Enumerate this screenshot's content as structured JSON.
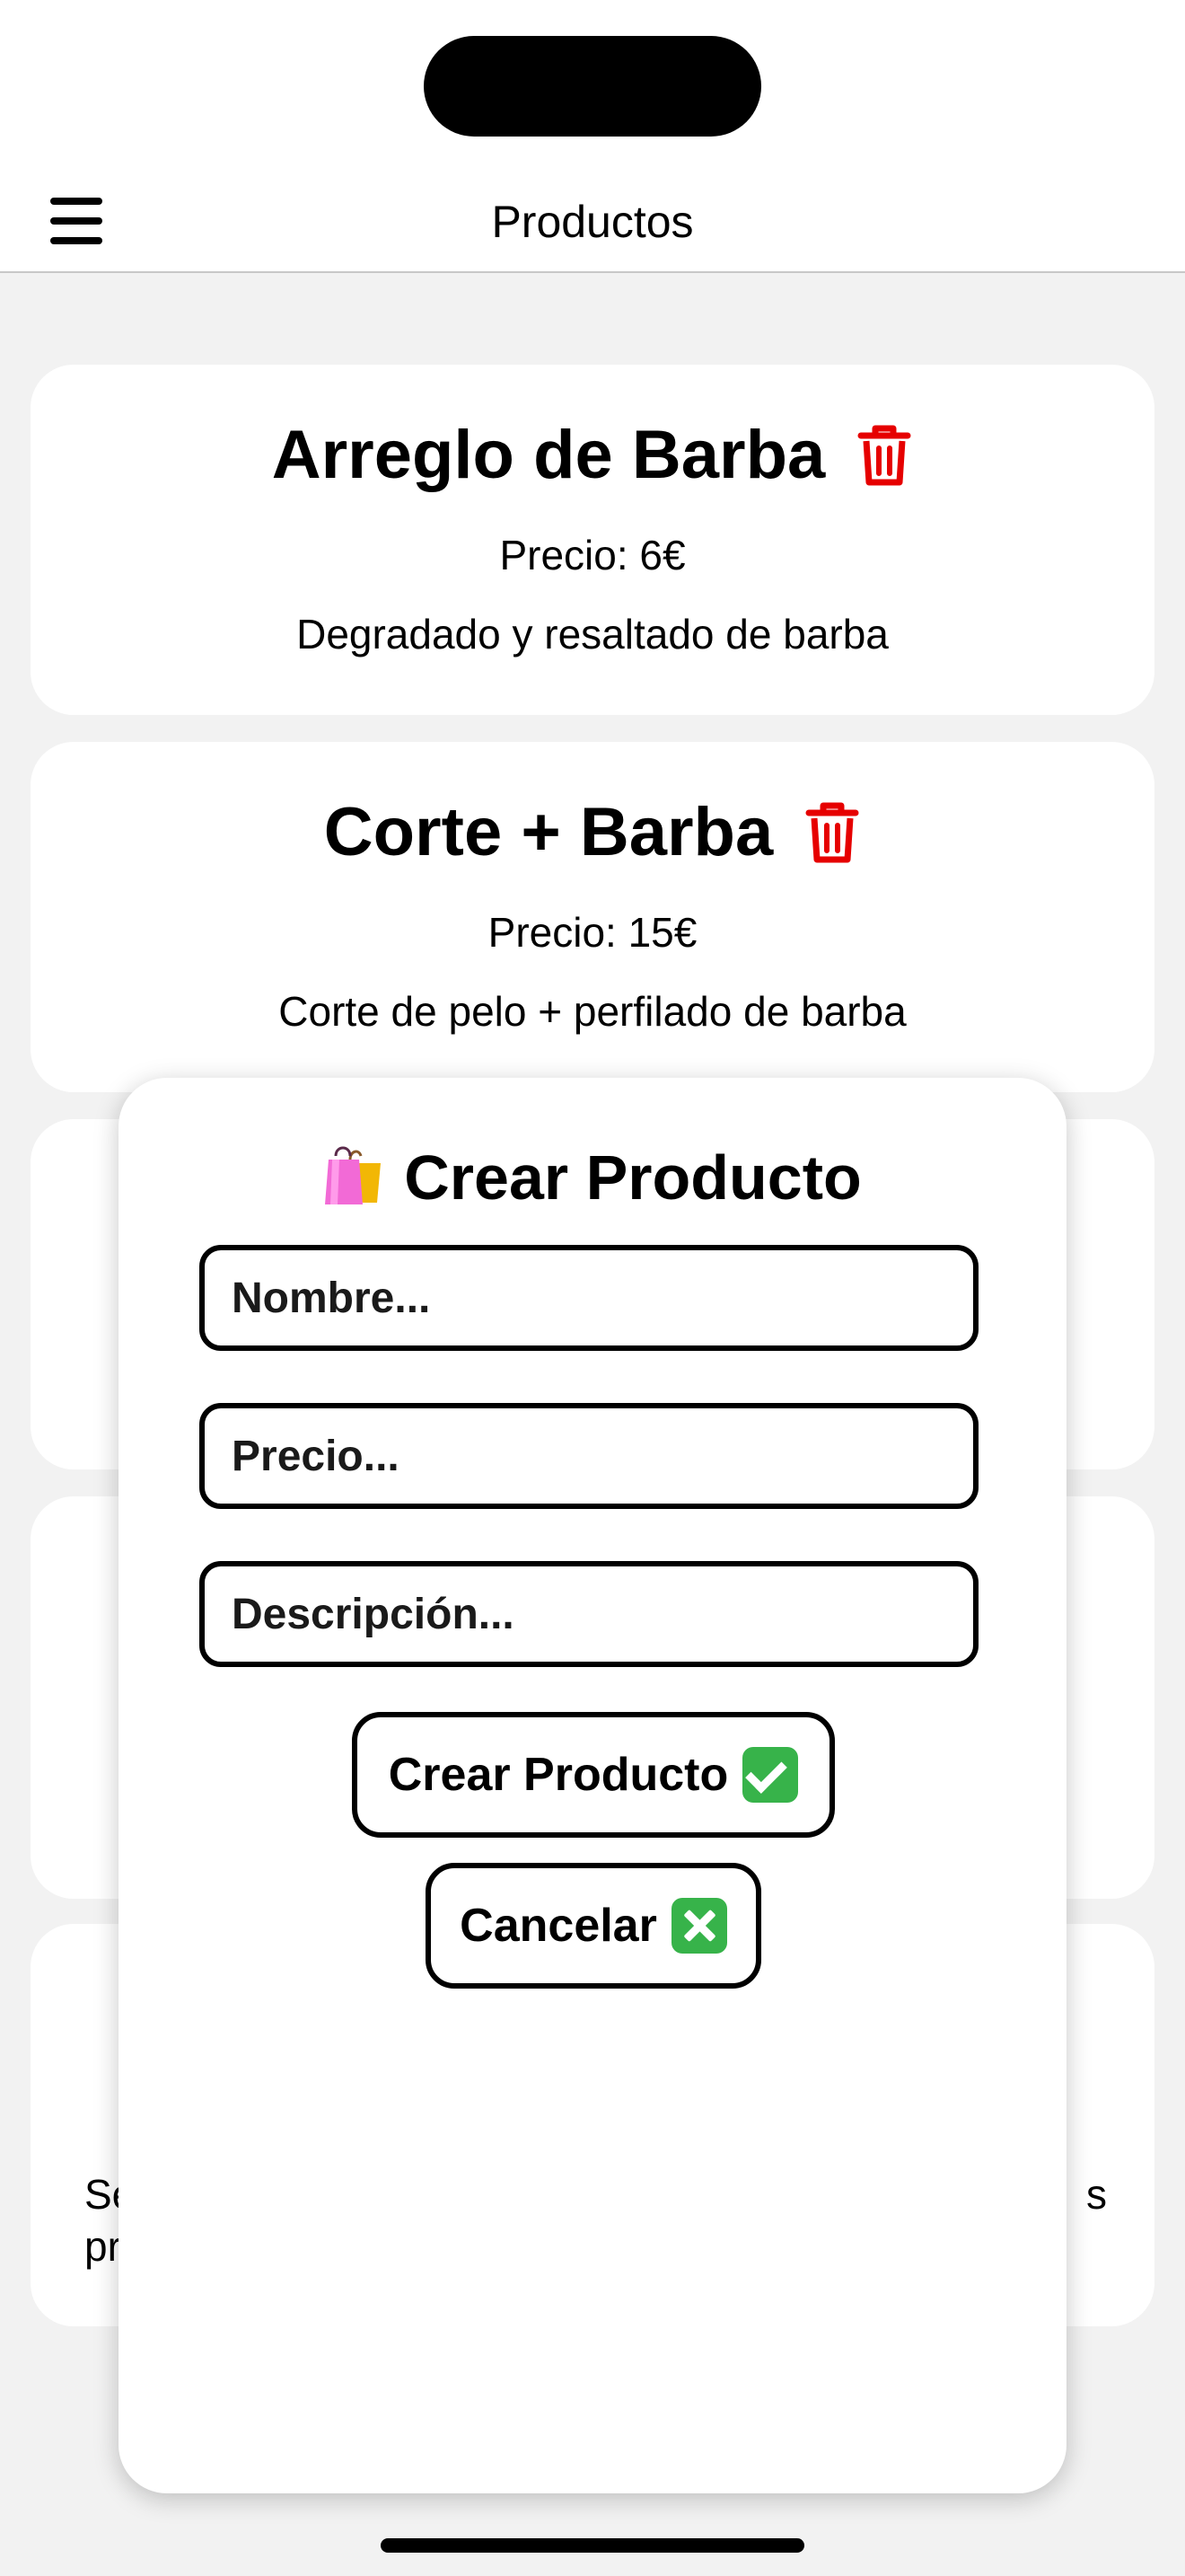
{
  "header": {
    "title": "Productos"
  },
  "products": [
    {
      "name": "Arreglo de Barba",
      "price": "Precio: 6€",
      "description": "Degradado y resaltado de barba"
    },
    {
      "name": "Corte + Barba",
      "price": "Precio: 15€",
      "description": "Corte de pelo + perfilado de barba"
    }
  ],
  "partial_card_text": {
    "left_line1": "Se",
    "left_line2": "pr",
    "right_line1": "s"
  },
  "modal": {
    "title": "Crear Producto",
    "title_icon": "shopping-bags-icon",
    "name_placeholder": "Nombre...",
    "price_placeholder": "Precio...",
    "description_placeholder": "Descripción...",
    "submit_label": "Crear Producto",
    "submit_icon": "check-mark-button-icon",
    "cancel_label": "Cancelar",
    "cancel_icon": "cross-mark-button-icon"
  },
  "colors": {
    "trash": "#e60000",
    "accent_green": "#37b34a",
    "background": "#f2f2f2"
  }
}
